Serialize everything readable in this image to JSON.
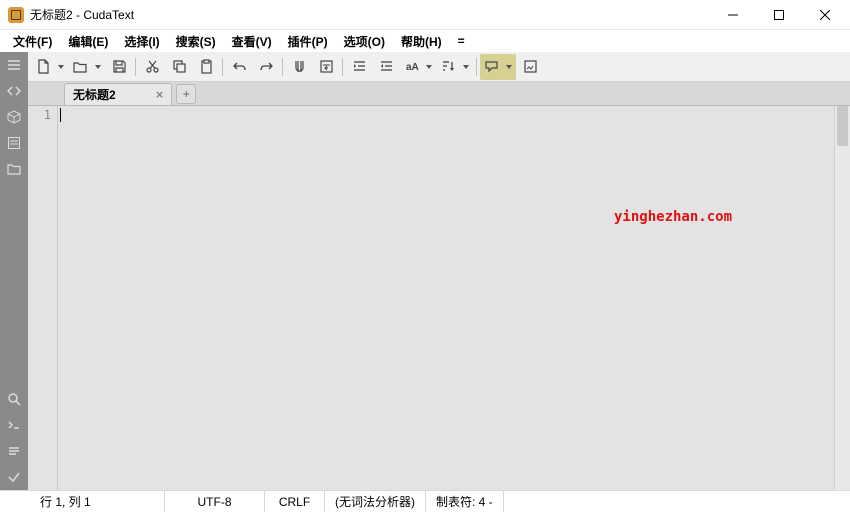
{
  "titlebar": {
    "title": "无标题2 - CudaText"
  },
  "menu": {
    "items": [
      "文件(F)",
      "编辑(E)",
      "选择(I)",
      "搜索(S)",
      "查看(V)",
      "插件(P)",
      "选项(O)",
      "帮助(H)",
      "="
    ]
  },
  "tabs": {
    "active": "无标题2"
  },
  "gutter": {
    "line1": "1"
  },
  "watermark": "yinghezhan.com",
  "status": {
    "pos": "行 1, 列 1",
    "encoding": "UTF-8",
    "eol": "CRLF",
    "lexer": "(无词法分析器)",
    "tabs": "制表符: 4 -"
  }
}
